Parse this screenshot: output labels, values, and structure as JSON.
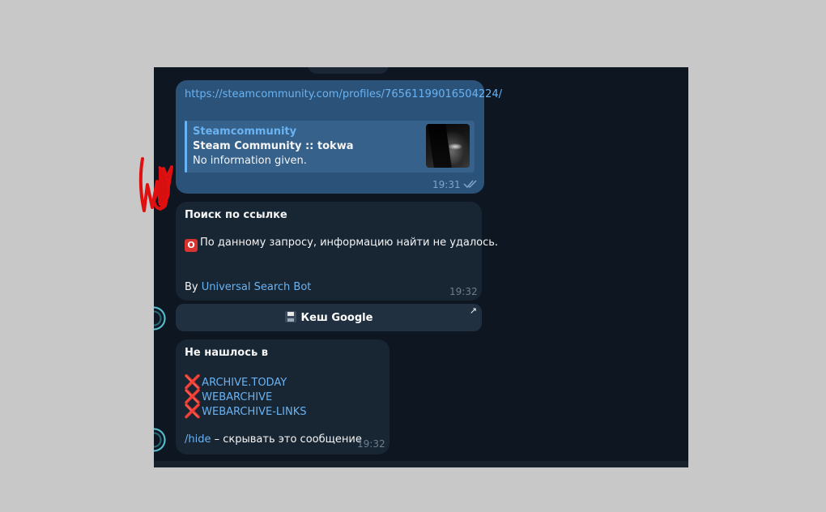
{
  "chat": {
    "messages": {
      "link_message": {
        "url": "https://steamcommunity.com/profiles/76561199016504224/",
        "preview": {
          "site_name": "Steamcommunity",
          "title": "Steam Community :: tokwa",
          "description": "No information given."
        },
        "time": "19:31",
        "status_icon": "double-check-icon"
      },
      "search_message": {
        "heading": "Поиск по ссылке",
        "result_icon": "stop-sign-icon",
        "result_badge": "O",
        "result_text": "По данному запросу, информацию найти не удалось.",
        "by_prefix": "By ",
        "bot_name": "Universal Search Bot",
        "time": "19:32",
        "button": {
          "icon": "floppy-disk-icon",
          "label": "Кеш Google",
          "corner_icon": "external-arrow-icon"
        }
      },
      "archive_message": {
        "heading": "Не нашлось в",
        "marker_glyph": "❌",
        "items": [
          "ARCHIVE.TODAY",
          "WEBARCHIVE",
          "WEBARCHIVE-LINKS"
        ],
        "hide_command": "/hide",
        "hide_text": " – скрывать это сообщение",
        "time": "19:32"
      }
    }
  },
  "colors": {
    "chat_background": "#0e1621",
    "outgoing_bubble": "#2b5278",
    "incoming_bubble": "#182533",
    "link": "#6ab3f3",
    "error_red": "#e03a3a",
    "scribble_red": "#e01010"
  }
}
